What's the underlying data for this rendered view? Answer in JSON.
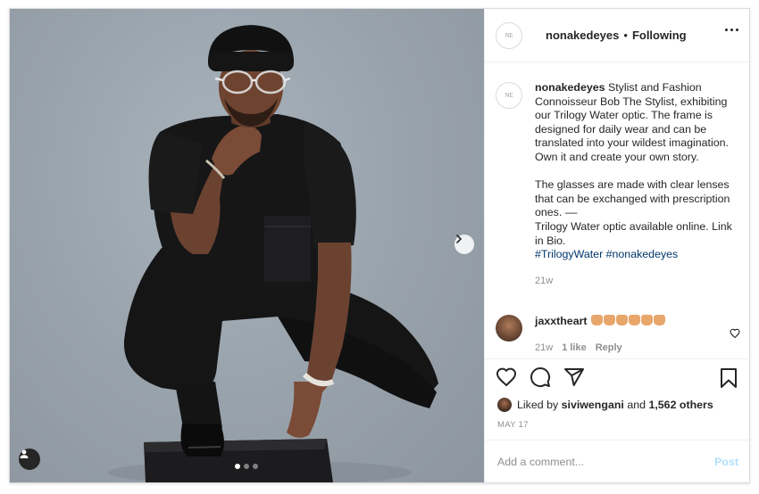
{
  "post": {
    "username": "nonakedeyes",
    "separator": "•",
    "follow_status": "Following",
    "logo_text": "NE",
    "carousel": {
      "total_slides": 3,
      "active_slide": 1
    }
  },
  "caption": {
    "username": "nonakedeyes",
    "text": "Stylist and Fashion Connoisseur Bob The Stylist, exhibiting our Trilogy Water optic. The frame is designed for daily wear and can be translated into your wildest imagination. Own it and create your own story.\n\nThe glasses are made with clear lenses that can be exchanged with prescription ones. ––\nTrilogy Water optic available online. Link in Bio.",
    "hashtags": "#TrilogyWater #nonakedeyes",
    "time": "21w"
  },
  "comment": {
    "username": "jaxxtheart",
    "emoji_count": 6,
    "time": "21w",
    "likes": "1 like",
    "reply": "Reply"
  },
  "likes": {
    "prefix": "Liked by",
    "user": "siviwengani",
    "and": "and",
    "others": "1,562 others"
  },
  "date": "MAY 17",
  "add_comment": {
    "placeholder": "Add a comment...",
    "post_label": "Post"
  },
  "icons": [
    "heart-icon",
    "comment-icon",
    "share-icon",
    "bookmark-icon",
    "more-icon",
    "chevron-right-icon",
    "user-tag-icon"
  ]
}
